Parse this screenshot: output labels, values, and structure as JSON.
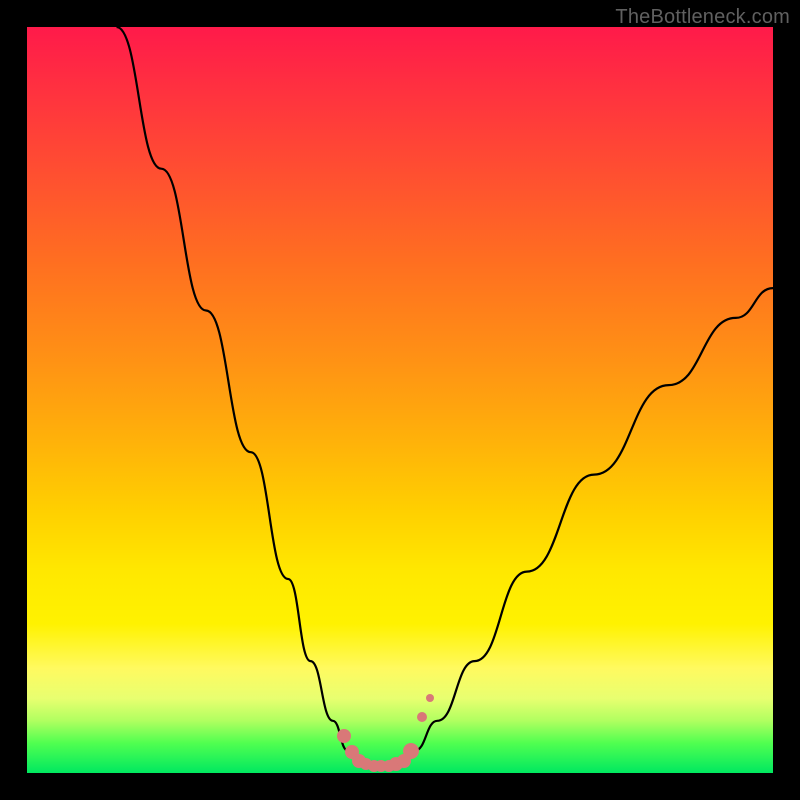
{
  "watermark": "TheBottleneck.com",
  "chart_data": {
    "type": "line",
    "title": "",
    "xlabel": "",
    "ylabel": "",
    "xlim": [
      0,
      100
    ],
    "ylim": [
      0,
      100
    ],
    "series": [
      {
        "name": "left-curve",
        "x": [
          12,
          18,
          24,
          30,
          35,
          38,
          41,
          43,
          44.5
        ],
        "y": [
          100,
          81,
          62,
          43,
          26,
          15,
          7,
          3,
          1.5
        ]
      },
      {
        "name": "right-curve",
        "x": [
          50.5,
          52,
          55,
          60,
          67,
          76,
          86,
          95,
          100
        ],
        "y": [
          1.5,
          3,
          7,
          15,
          27,
          40,
          52,
          61,
          65
        ]
      },
      {
        "name": "valley-floor",
        "x": [
          44.5,
          47.5,
          50.5
        ],
        "y": [
          1.5,
          1.0,
          1.5
        ]
      }
    ],
    "markers": [
      {
        "x": 42.5,
        "y": 5.0,
        "size": 14
      },
      {
        "x": 43.5,
        "y": 2.8,
        "size": 14
      },
      {
        "x": 44.5,
        "y": 1.6,
        "size": 14
      },
      {
        "x": 45.5,
        "y": 1.2,
        "size": 12
      },
      {
        "x": 46.5,
        "y": 1.0,
        "size": 12
      },
      {
        "x": 47.5,
        "y": 0.9,
        "size": 12
      },
      {
        "x": 48.5,
        "y": 1.0,
        "size": 12
      },
      {
        "x": 49.5,
        "y": 1.2,
        "size": 14
      },
      {
        "x": 50.5,
        "y": 1.6,
        "size": 14
      },
      {
        "x": 51.5,
        "y": 3.0,
        "size": 16
      },
      {
        "x": 53.0,
        "y": 7.5,
        "size": 10
      },
      {
        "x": 54.0,
        "y": 10.0,
        "size": 8
      }
    ],
    "colors": {
      "curve": "#000000",
      "marker": "#d97878",
      "background_top": "#ff1a4a",
      "background_bottom": "#00e860",
      "frame": "#000000"
    }
  }
}
